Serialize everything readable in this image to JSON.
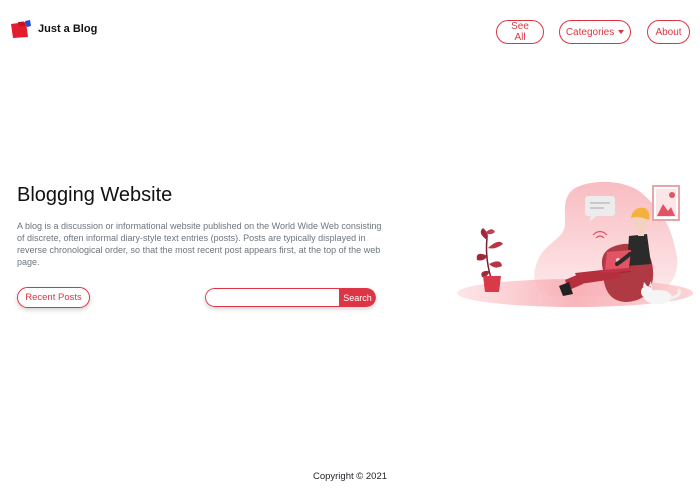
{
  "brand": {
    "name": "Just a Blog"
  },
  "nav": {
    "see_all": "See All",
    "categories": "Categories",
    "about": "About"
  },
  "hero": {
    "title": "Blogging Website",
    "description": "A blog is a discussion or informational website published on the World Wide Web consisting of discrete, often informal diary-style text entries (posts). Posts are typically displayed in reverse chronological order, so that the most recent post appears first, at the top of the web page.",
    "recent_posts": "Recent Posts"
  },
  "search": {
    "placeholder": "",
    "button": "Search"
  },
  "footer": {
    "copyright": "Copyright © 2021"
  },
  "colors": {
    "accent": "#dc3545",
    "text": "#212529",
    "muted": "#6c757d"
  },
  "icons": {
    "brand": "blog-logo-icon",
    "illustration": "person-reading-laptop-illustration"
  }
}
